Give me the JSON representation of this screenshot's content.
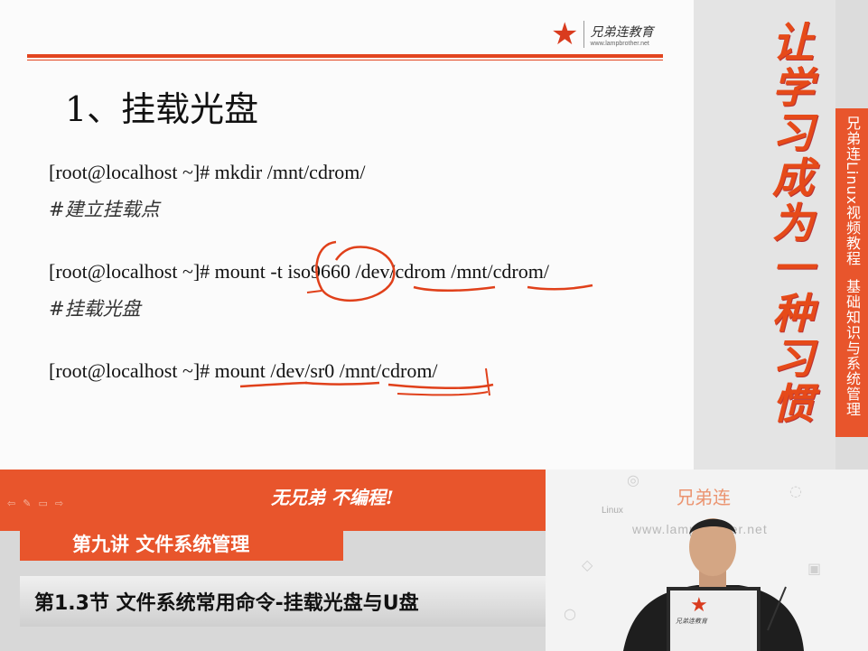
{
  "slide": {
    "logo_text": "兄弟连教育",
    "logo_url": "www.lampbrother.net",
    "title": "1、挂载光盘",
    "commands": [
      {
        "cmd": "[root@localhost ~]# mkdir /mnt/cdrom/",
        "comment": "#建立挂载点"
      },
      {
        "cmd": "[root@localhost ~]# mount -t iso9660 /dev/cdrom /mnt/cdrom/",
        "comment": "#挂载光盘"
      },
      {
        "cmd": "[root@localhost ~]# mount /dev/sr0 /mnt/cdrom/",
        "comment": ""
      }
    ]
  },
  "calligraphy": "让学习成为一种习惯",
  "sidebar": {
    "course": "兄弟连Linux视频教程",
    "topic": "基础知识与系统管理"
  },
  "bottom": {
    "slogan": "无兄弟 不编程!",
    "lecture": "第九讲 文件系统管理",
    "section": "第1.3节 文件系统常用命令-挂载光盘与U盘"
  },
  "video": {
    "watermark": "兄弟连",
    "linux_label": "Linux",
    "url": "www.lampbrother.net",
    "laptop_brand": "兄弟连教育"
  },
  "colors": {
    "accent": "#e8552c",
    "annotation": "#e0401a"
  }
}
